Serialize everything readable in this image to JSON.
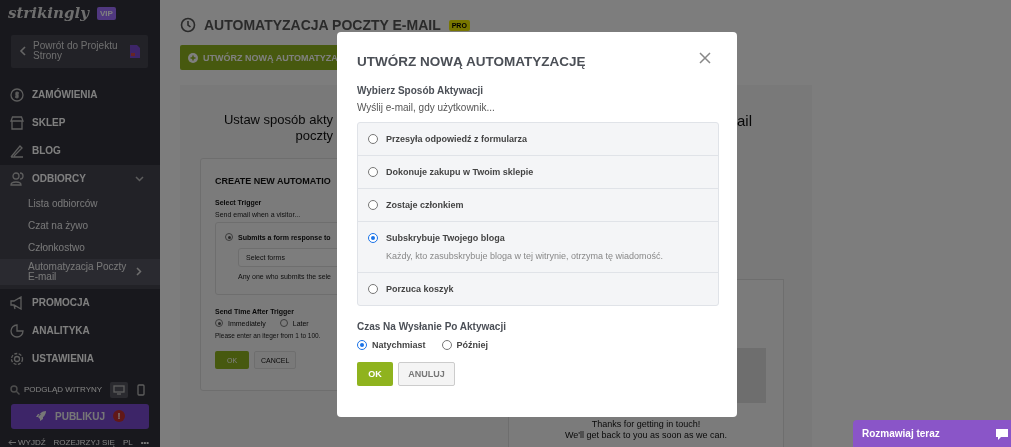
{
  "sidebar": {
    "logo": "strikingly",
    "badge": "VIP",
    "back_button": "Powrót do Projektu Strony",
    "nav": [
      {
        "label": "ZAMÓWIENIA",
        "expanded": false
      },
      {
        "label": "SKLEP",
        "expanded": false
      },
      {
        "label": "BLOG",
        "expanded": false
      },
      {
        "label": "ODBIORCY",
        "expanded": true,
        "children": [
          {
            "label": "Lista odbiorców",
            "selected": false
          },
          {
            "label": "Czat na żywo",
            "selected": false
          },
          {
            "label": "Członkostwo",
            "selected": false
          },
          {
            "label": "Automatyzacja Poczty E-mail",
            "selected": true
          }
        ]
      },
      {
        "label": "PROMOCJA",
        "expanded": false
      },
      {
        "label": "ANALITYKA",
        "expanded": false
      },
      {
        "label": "USTAWIENIA",
        "expanded": false
      }
    ],
    "preview": {
      "label": "PODGLĄD WITRYNY",
      "devices": [
        {
          "selected": true
        },
        {
          "selected": false
        }
      ]
    },
    "publish": {
      "label": "PUBLIKUJ",
      "alert": "!"
    },
    "footer": [
      "WYJDŹ",
      "ROZEJRZYJ SIĘ",
      "PL",
      "•••"
    ]
  },
  "page": {
    "title": "AUTOMATYZACJA POCZTY E-MAIL",
    "badge": "PRO",
    "create_button": "UTWÓRZ NOWĄ AUTOMATYZA",
    "heading_lines": [
      "Ustaw sposób akty",
      "poczty"
    ],
    "heading_tail": "ail",
    "form_card": {
      "title": "CREATE NEW AUTOMATIO",
      "trigger_label": "Select Trigger",
      "trigger_hint": "Send email when a visitor...",
      "option": {
        "label": "Submits a form response to",
        "selected": true
      },
      "select_placeholder": "Select forms",
      "note": "Any one who submits the sele",
      "send_time_label": "Send Time After Trigger",
      "send_options": [
        {
          "label": "Immediately",
          "selected": true
        },
        {
          "label": "Later",
          "selected": false
        }
      ],
      "hint": "Please enter an iteger  from 1 to 100.",
      "ok": "OK",
      "cancel": "CANCEL"
    },
    "preview_message": [
      "Thanks for getting in touch!",
      "We'll get back to you as soon as we can."
    ]
  },
  "modal": {
    "title": "UTWÓRZ NOWĄ AUTOMATYZACJĘ",
    "trigger_label": "Wybierz Sposób Aktywacji",
    "trigger_hint": "Wyślij e-mail, gdy użytkownik...",
    "options": [
      {
        "label": "Przesyła odpowiedź z formularza",
        "selected": false
      },
      {
        "label": "Dokonuje zakupu w Twoim sklepie",
        "selected": false
      },
      {
        "label": "Zostaje członkiem",
        "selected": false
      },
      {
        "label": "Subskrybuje Twojego bloga",
        "selected": true,
        "description": "Każdy, kto zasubskrybuje bloga w tej witrynie, otrzyma tę wiadomość."
      },
      {
        "label": "Porzuca koszyk",
        "selected": false
      }
    ],
    "send_time_label": "Czas Na Wysłanie Po Aktywacji",
    "send_options": [
      {
        "label": "Natychmiast",
        "selected": true
      },
      {
        "label": "Później",
        "selected": false
      }
    ],
    "ok": "OK",
    "cancel": "ANULUJ"
  },
  "chat_button": "Rozmawiaj teraz"
}
